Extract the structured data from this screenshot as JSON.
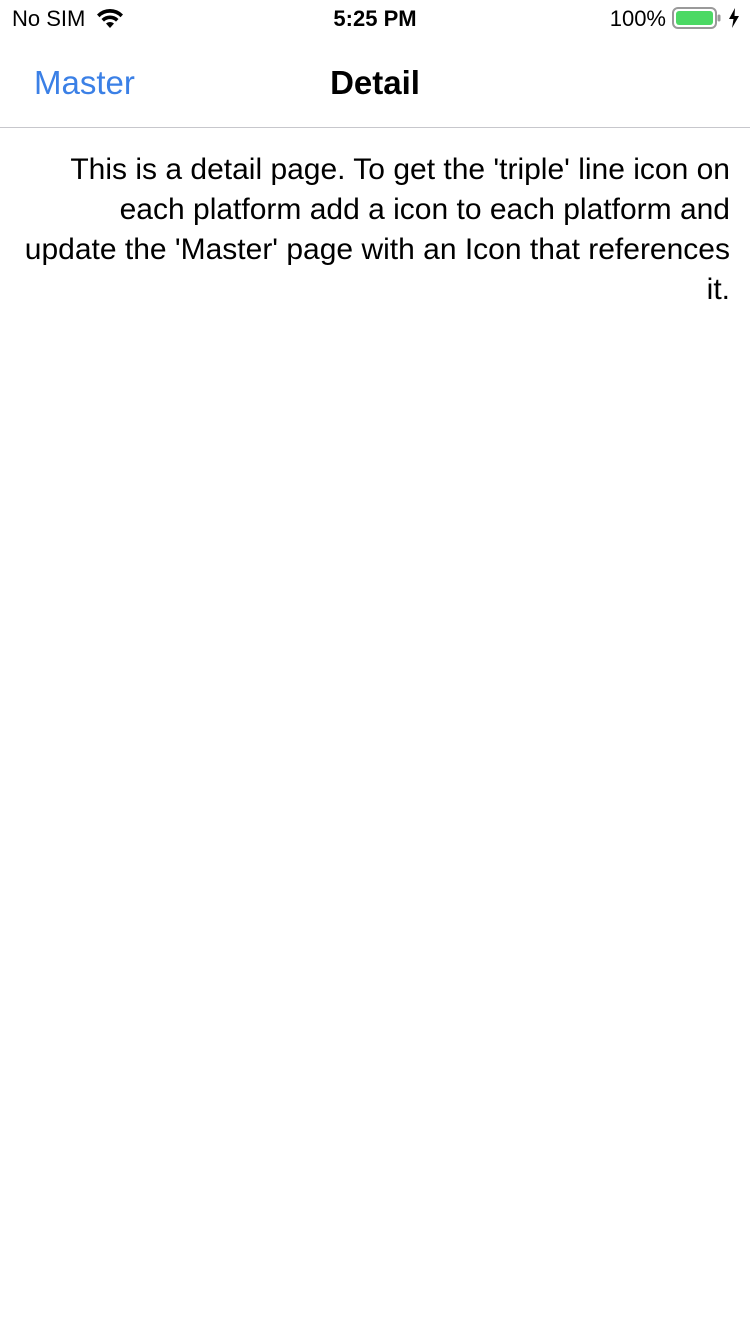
{
  "status_bar": {
    "carrier": "No SIM",
    "time": "5:25 PM",
    "battery_percent_label": "100%",
    "battery_level": 1.0,
    "icons": [
      "wifi-icon",
      "battery-icon",
      "charging-bolt-icon"
    ],
    "battery_color": "#4cd964"
  },
  "nav": {
    "back_label": "Master",
    "title": "Detail",
    "accent_color": "#3b80e6"
  },
  "content": {
    "text": "This is a detail page. To get the 'triple' line icon on each platform add a icon to each platform and update the 'Master' page with an Icon that references it."
  }
}
